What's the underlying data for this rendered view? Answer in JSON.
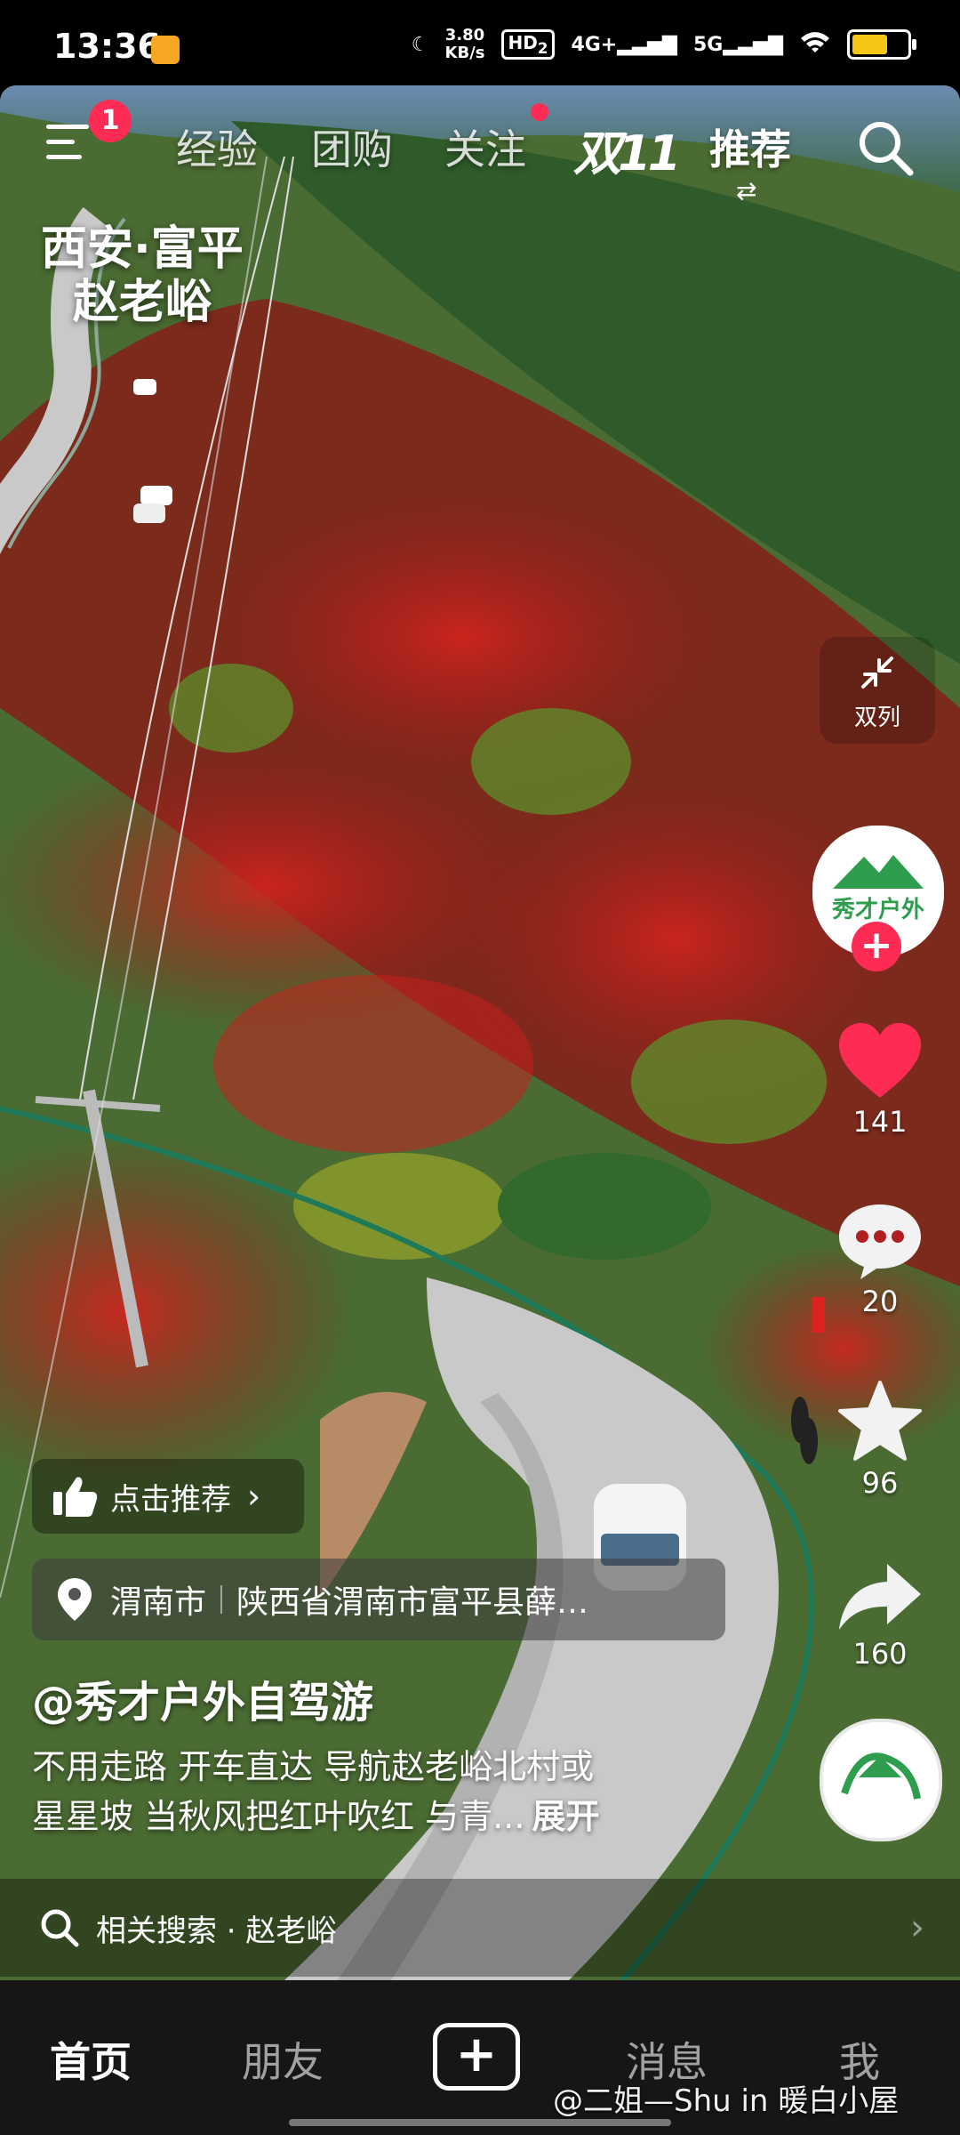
{
  "status_bar": {
    "time": "13:36",
    "net_speed_value": "3.80",
    "net_speed_unit": "KB/s",
    "hd": "HD",
    "hd_sub": "2",
    "signal_4g": "4G+",
    "signal_5g": "5G",
    "battery_level": 0.7
  },
  "top_nav": {
    "menu_badge": "1",
    "tabs": [
      "经验",
      "团购",
      "关注",
      "推荐"
    ],
    "double11": "双11",
    "active_tab": "推荐"
  },
  "video": {
    "caption_line1": "西安·富平",
    "caption_line2": "赵老峪"
  },
  "right_rail": {
    "dual_col_label": "双列",
    "author_logo_text": "秀才户外",
    "likes": "141",
    "comments": "20",
    "favorites": "96",
    "shares": "160"
  },
  "info": {
    "recommend_label": "点击推荐",
    "city": "渭南市",
    "address": "陕西省渭南市富平县薛…",
    "author": "@秀才户外自驾游",
    "desc_line1": "不用走路 开车直达 导航赵老峪北村或",
    "desc_line2": "星星坡 当秋风把红叶吹红 与青...",
    "expand": "展开",
    "related_search": "相关搜索 · 赵老峪"
  },
  "tab_bar": {
    "home": "首页",
    "friends": "朋友",
    "messages": "消息",
    "me": "我",
    "create": "+"
  },
  "watermark": "@二姐—Shu in 暖白小屋",
  "colors": {
    "accent": "#fe2c55",
    "tab_bar_bg": "#161616",
    "foliage_red": "#c8201e",
    "foliage_green": "#3d6a2a"
  }
}
